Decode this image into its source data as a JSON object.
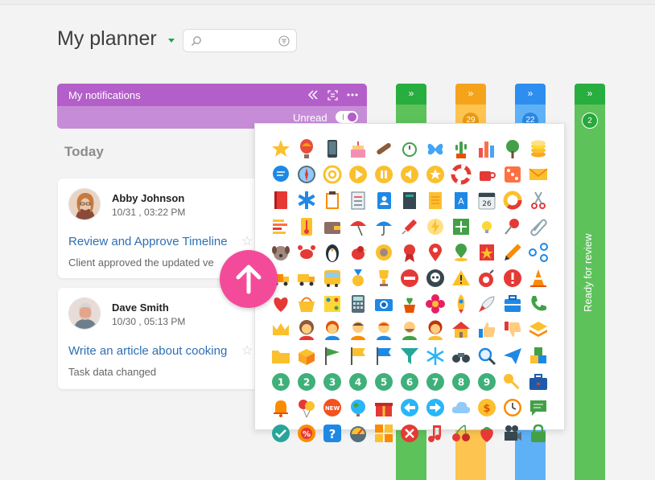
{
  "header": {
    "title": "My planner",
    "search": {
      "value": "",
      "placeholder": ""
    }
  },
  "notifications": {
    "title": "My notifications",
    "unread_label": "Unread",
    "unread_on": true
  },
  "section": {
    "today": "Today"
  },
  "cards": [
    {
      "name": "Abby Johnson",
      "date": "10/31 , 03:22 PM",
      "task": "Review and Approve Timeline",
      "description": "Client approved the updated ve"
    },
    {
      "name": "Dave Smith",
      "date": "10/30 , 05:13 PM",
      "task": "Write an article about cooking",
      "description": "Task data changed"
    }
  ],
  "columns": [
    {
      "color": "#27ae3e",
      "count": "",
      "label": ""
    },
    {
      "color": "#f6a31c",
      "count": "29",
      "label": ""
    },
    {
      "color": "#2d8ef0",
      "count": "22",
      "label": ""
    },
    {
      "color": "#27ae3e",
      "count": "2",
      "label": "Ready for review"
    }
  ],
  "icon_picker": {
    "number_icons": [
      "1",
      "2",
      "3",
      "4",
      "5",
      "6",
      "7",
      "8",
      "9"
    ],
    "new_badge": "NEW",
    "calendar_day": "26",
    "icons": [
      "star-icon",
      "hot-air-balloon-icon",
      "smartphone-icon",
      "cake-icon",
      "cigar-icon",
      "alarm-clock-icon",
      "butterfly-icon",
      "cactus-icon",
      "bar-chart-icon",
      "tree-icon",
      "coins-icon",
      "chat-bubble-icon",
      "compass-icon",
      "at-sign-icon",
      "play-icon",
      "pause-icon",
      "volume-icon",
      "star-badge-icon",
      "lifebuoy-icon",
      "coffee-cup-icon",
      "dice-icon",
      "envelope-icon",
      "book-icon",
      "medical-star-icon",
      "clipboard-icon",
      "checklist-icon",
      "contacts-icon",
      "notebook-icon",
      "notepad-icon",
      "dictionary-icon",
      "calendar-icon",
      "donut-chart-icon",
      "scissors-icon",
      "gantt-chart-icon",
      "thermometer-icon",
      "wallet-icon",
      "umbrella-open-icon",
      "umbrella-icon",
      "syringe-icon",
      "lightbulb-icon",
      "plus-icon",
      "bright-bulb-icon",
      "pushpin-icon",
      "paperclip-icon",
      "dog-icon",
      "crab-icon",
      "penguin-icon",
      "bird-icon",
      "sunflower-icon",
      "ribbon-badge-icon",
      "map-pin-icon",
      "location-pin-icon",
      "star-flag-icon",
      "pencil-icon",
      "share-icon",
      "truck-icon",
      "truck-yellow-icon",
      "bus-icon",
      "medal-icon",
      "trophy-icon",
      "no-entry-icon",
      "skull-icon",
      "warning-icon",
      "bomb-icon",
      "exclamation-icon",
      "traffic-cone-icon",
      "heart-icon",
      "basket-icon",
      "board-game-icon",
      "calculator-icon",
      "camera-icon",
      "flower-pot-icon",
      "flower-icon",
      "rocket-icon",
      "rocket-small-icon",
      "toolbox-icon",
      "phone-icon",
      "crown-icon",
      "woman-icon",
      "girl-icon",
      "man-icon",
      "boy-icon",
      "man-beard-icon",
      "woman-red-icon",
      "house-icon",
      "thumbs-up-icon",
      "thumbs-down-icon",
      "layers-icon",
      "folder-icon",
      "box-icon",
      "green-flag-icon",
      "yellow-flag-icon",
      "blue-flag-icon",
      "filter-icon",
      "snowflake-icon",
      "binoculars-icon",
      "magnifier-icon",
      "paper-plane-icon",
      "abc-blocks-icon",
      "number-1-icon",
      "number-2-icon",
      "number-3-icon",
      "number-4-icon",
      "number-5-icon",
      "number-6-icon",
      "number-7-icon",
      "number-8-icon",
      "number-9-icon",
      "key-icon",
      "briefcase-icon",
      "bell-icon",
      "balloons-icon",
      "new-badge-icon",
      "globe-icon",
      "gift-icon",
      "arrow-left-icon",
      "arrow-right-icon",
      "cloud-icon",
      "dollar-coin-icon",
      "clock-icon",
      "message-icon",
      "check-circle-icon",
      "percent-icon",
      "question-icon",
      "speedometer-icon",
      "calc-keys-icon",
      "close-circle-icon",
      "music-note-icon",
      "cherries-icon",
      "strawberry-icon",
      "film-camera-icon",
      "padlock-icon"
    ]
  }
}
